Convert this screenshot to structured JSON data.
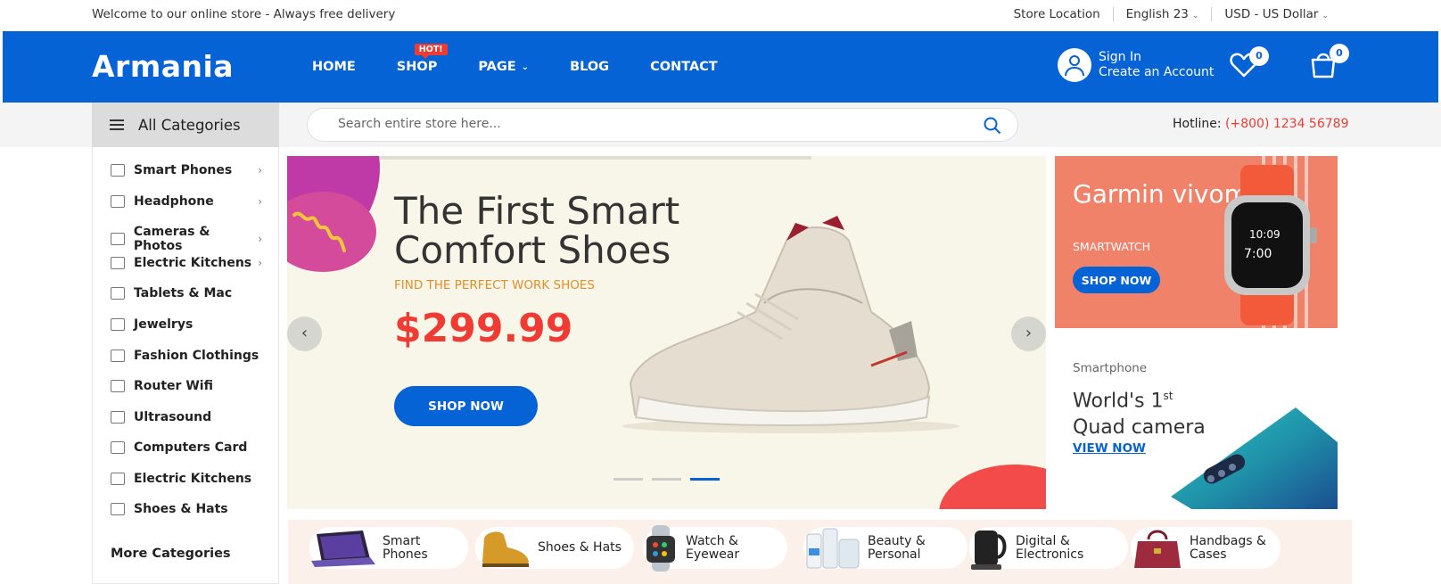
{
  "topbar": {
    "welcome": "Welcome to our online store - Always free delivery",
    "store_location": "Store Location",
    "language": "English 23",
    "currency": "USD - US Dollar"
  },
  "header": {
    "logo": "Armania",
    "nav": [
      {
        "label": "HOME"
      },
      {
        "label": "SHOP",
        "badge": "HOT!"
      },
      {
        "label": "PAGE"
      },
      {
        "label": "BLOG"
      },
      {
        "label": "CONTACT"
      }
    ],
    "sign_in": "Sign In",
    "create_account": "Create an Account",
    "wishlist_count": "0",
    "cart_count": "0"
  },
  "subbar": {
    "all_categories": "All Categories",
    "search_placeholder": "Search entire store here...",
    "hotline_label": "Hotline:",
    "hotline_number": "(+800) 1234 56789"
  },
  "sidebar": {
    "items": [
      {
        "label": "Smart Phones",
        "icon": "phone-icon",
        "has_submenu": true
      },
      {
        "label": "Headphone",
        "icon": "headphone-icon",
        "has_submenu": true
      },
      {
        "label": "Cameras & Photos",
        "icon": "camera-icon",
        "has_submenu": true
      },
      {
        "label": "Electric Kitchens",
        "icon": "kitchen-icon",
        "has_submenu": true
      },
      {
        "label": "Tablets & Mac",
        "icon": "tablet-icon",
        "has_submenu": false
      },
      {
        "label": "Jewelrys",
        "icon": "jewelry-icon",
        "has_submenu": false
      },
      {
        "label": "Fashion Clothings",
        "icon": "clothing-icon",
        "has_submenu": false
      },
      {
        "label": "Router Wifi",
        "icon": "router-icon",
        "has_submenu": false
      },
      {
        "label": "Ultrasound",
        "icon": "ultrasound-icon",
        "has_submenu": false
      },
      {
        "label": "Computers Card",
        "icon": "computer-card-icon",
        "has_submenu": false
      },
      {
        "label": "Electric Kitchens",
        "icon": "kitchen-icon",
        "has_submenu": false
      },
      {
        "label": "Shoes & Hats",
        "icon": "shoe-icon",
        "has_submenu": false
      }
    ],
    "more": "More Categories"
  },
  "slider": {
    "title": "The First Smart Comfort Shoes",
    "subtitle": "FIND THE PERFECT WORK SHOES",
    "price": "$299.99",
    "button": "SHOP NOW",
    "active_slide": 3,
    "slide_count": 3
  },
  "banner1": {
    "title": "Garmin vivomove",
    "subtitle": "SMARTWATCH",
    "button": "SHOP NOW"
  },
  "banner2": {
    "category": "Smartphone",
    "title_line1": "World's 1",
    "title_sup": "st",
    "title_line2": "Quad camera",
    "link": "VIEW NOW"
  },
  "categories_strip": [
    {
      "label": "Smart\nPhones",
      "icon": "tablet-product-icon"
    },
    {
      "label": "Shoes & Hats",
      "icon": "boot-product-icon"
    },
    {
      "label": "Watch &\nEyewear",
      "icon": "watch-product-icon"
    },
    {
      "label": "Beauty &\nPersonal",
      "icon": "beauty-product-icon"
    },
    {
      "label": "Digital &\nElectronics",
      "icon": "kettle-product-icon"
    },
    {
      "label": "Handbags &\nCases",
      "icon": "handbag-product-icon"
    }
  ],
  "colors": {
    "brand": "#0563d6",
    "accent_red": "#ef3b34",
    "accent_orange": "#e0902a"
  }
}
